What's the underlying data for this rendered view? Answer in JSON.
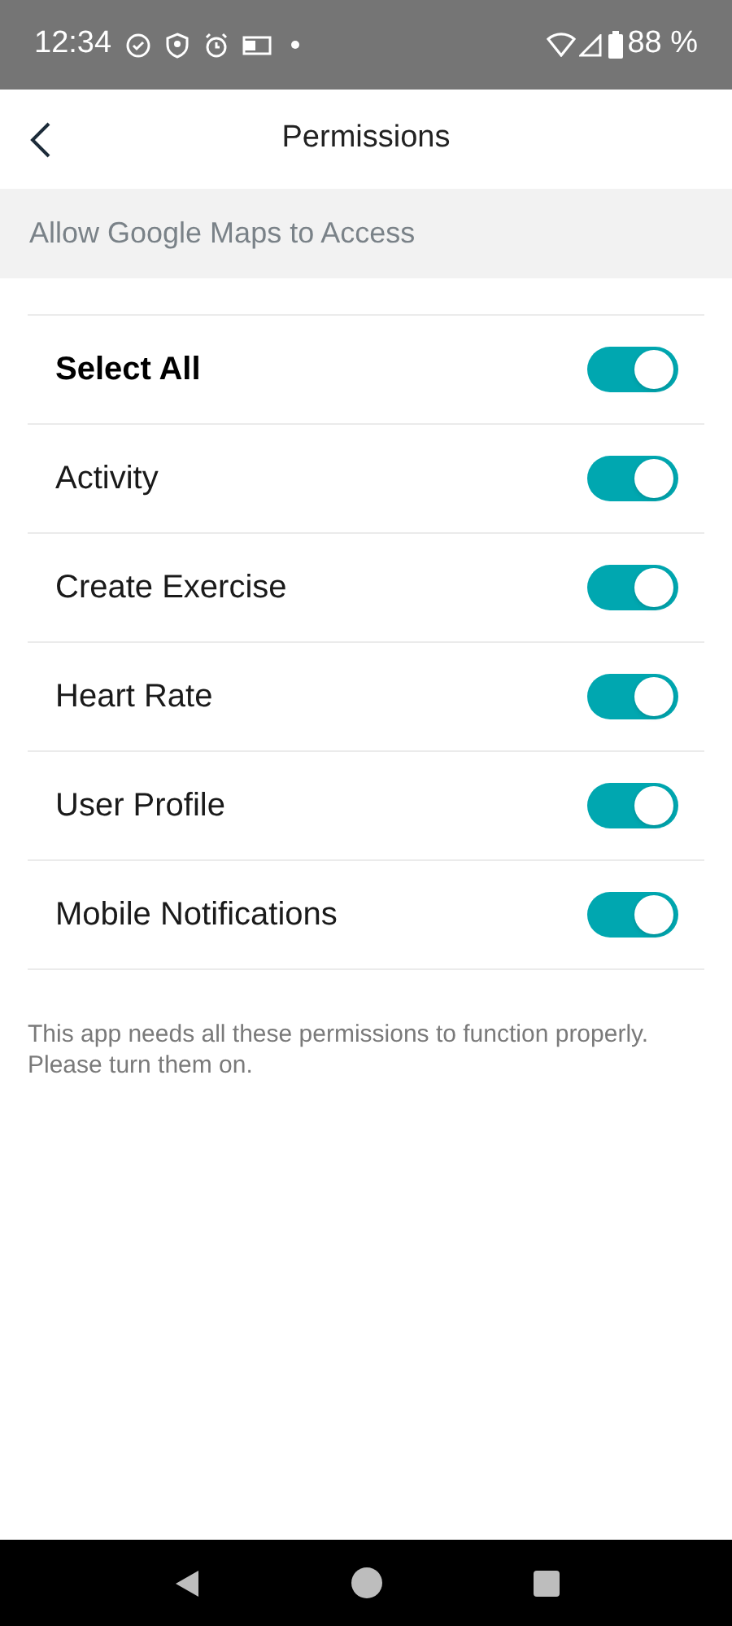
{
  "status_bar": {
    "time": "12:34",
    "battery": "88 %"
  },
  "header": {
    "title": "Permissions"
  },
  "section": {
    "title": "Allow Google Maps to Access"
  },
  "permissions": [
    {
      "kind": "master",
      "label": "Select All",
      "on": true
    },
    {
      "kind": "item",
      "label": "Activity",
      "on": true
    },
    {
      "kind": "item",
      "label": "Create Exercise",
      "on": true
    },
    {
      "kind": "item",
      "label": "Heart Rate",
      "on": true
    },
    {
      "kind": "item",
      "label": "User Profile",
      "on": true
    },
    {
      "kind": "item",
      "label": "Mobile Notifications",
      "on": true
    }
  ],
  "note": "This app needs all these permissions to function properly. Please turn them on."
}
